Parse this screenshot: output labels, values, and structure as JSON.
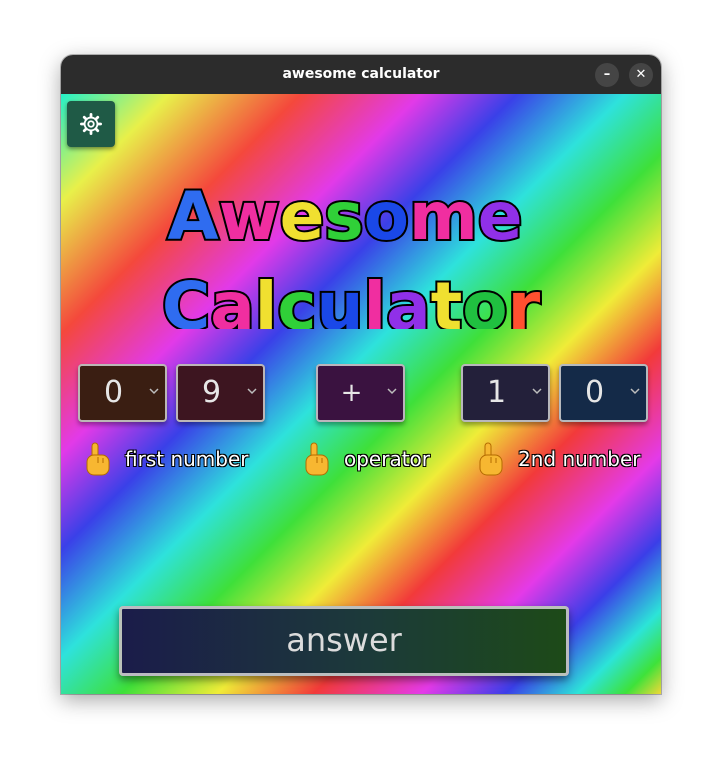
{
  "window": {
    "title": "awesome calculator",
    "minimize_glyph": "–",
    "close_glyph": "✕"
  },
  "settings": {
    "icon": "gear-icon"
  },
  "logo": {
    "line1": "Awesome",
    "line2": "Calculator"
  },
  "first_number": {
    "tens": "0",
    "ones": "9",
    "label": "first number"
  },
  "operator": {
    "value": "+",
    "label": "operator"
  },
  "second_number": {
    "tens": "1",
    "ones": "0",
    "label": "2nd number"
  },
  "answer": {
    "label": "answer"
  },
  "colors": {
    "titlebar": "#2c2c2c",
    "settings_button": "#1f5a46",
    "letter_palette": [
      "#2f6cf0",
      "#f02ea0",
      "#f0e030",
      "#30d038",
      "#1a48e8",
      "#f02ea0",
      "#9030e8",
      "#f0e030",
      "#20c040",
      "#ff5030",
      "#30d0f0"
    ]
  }
}
